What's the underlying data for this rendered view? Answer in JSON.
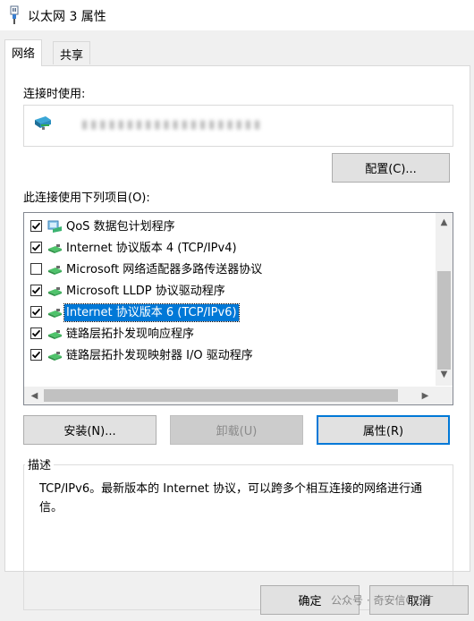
{
  "window": {
    "title": "以太网 3 属性"
  },
  "tabs": [
    {
      "label": "网络"
    },
    {
      "label": "共享"
    }
  ],
  "connect_using_label": "连接时使用:",
  "adapter_name": "▮▮▮▮▮▮▮▮▮▮▮▮▮▮▮▮▮▮▮▮",
  "configure_label": "配置(C)...",
  "items_label": "此连接使用下列项目(O):",
  "components": [
    {
      "label": "QoS 数据包计划程序",
      "checked": true,
      "icon": "qos-icon",
      "selected": false
    },
    {
      "label": "Internet 协议版本 4 (TCP/IPv4)",
      "checked": true,
      "icon": "protocol-icon",
      "selected": false
    },
    {
      "label": "Microsoft 网络适配器多路传送器协议",
      "checked": false,
      "icon": "protocol-icon",
      "selected": false
    },
    {
      "label": "Microsoft LLDP 协议驱动程序",
      "checked": true,
      "icon": "protocol-icon",
      "selected": false
    },
    {
      "label": "Internet 协议版本 6 (TCP/IPv6)",
      "checked": true,
      "icon": "protocol-icon",
      "selected": true
    },
    {
      "label": "链路层拓扑发现响应程序",
      "checked": true,
      "icon": "protocol-icon",
      "selected": false
    },
    {
      "label": "链路层拓扑发现映射器 I/O 驱动程序",
      "checked": true,
      "icon": "protocol-icon",
      "selected": false
    }
  ],
  "buttons": {
    "install": "安装(N)...",
    "uninstall": "卸载(U)",
    "properties": "属性(R)",
    "ok": "确定",
    "cancel": "取消"
  },
  "description": {
    "legend": "描述",
    "text": "TCP/IPv6。最新版本的 Internet 协议，可以跨多个相互连接的网络进行通信。"
  },
  "watermark": "公众号 · 奇安信CERT",
  "colors": {
    "selection": "#0078d7",
    "checkmark": "#000000",
    "default_border": "#0078d7"
  }
}
